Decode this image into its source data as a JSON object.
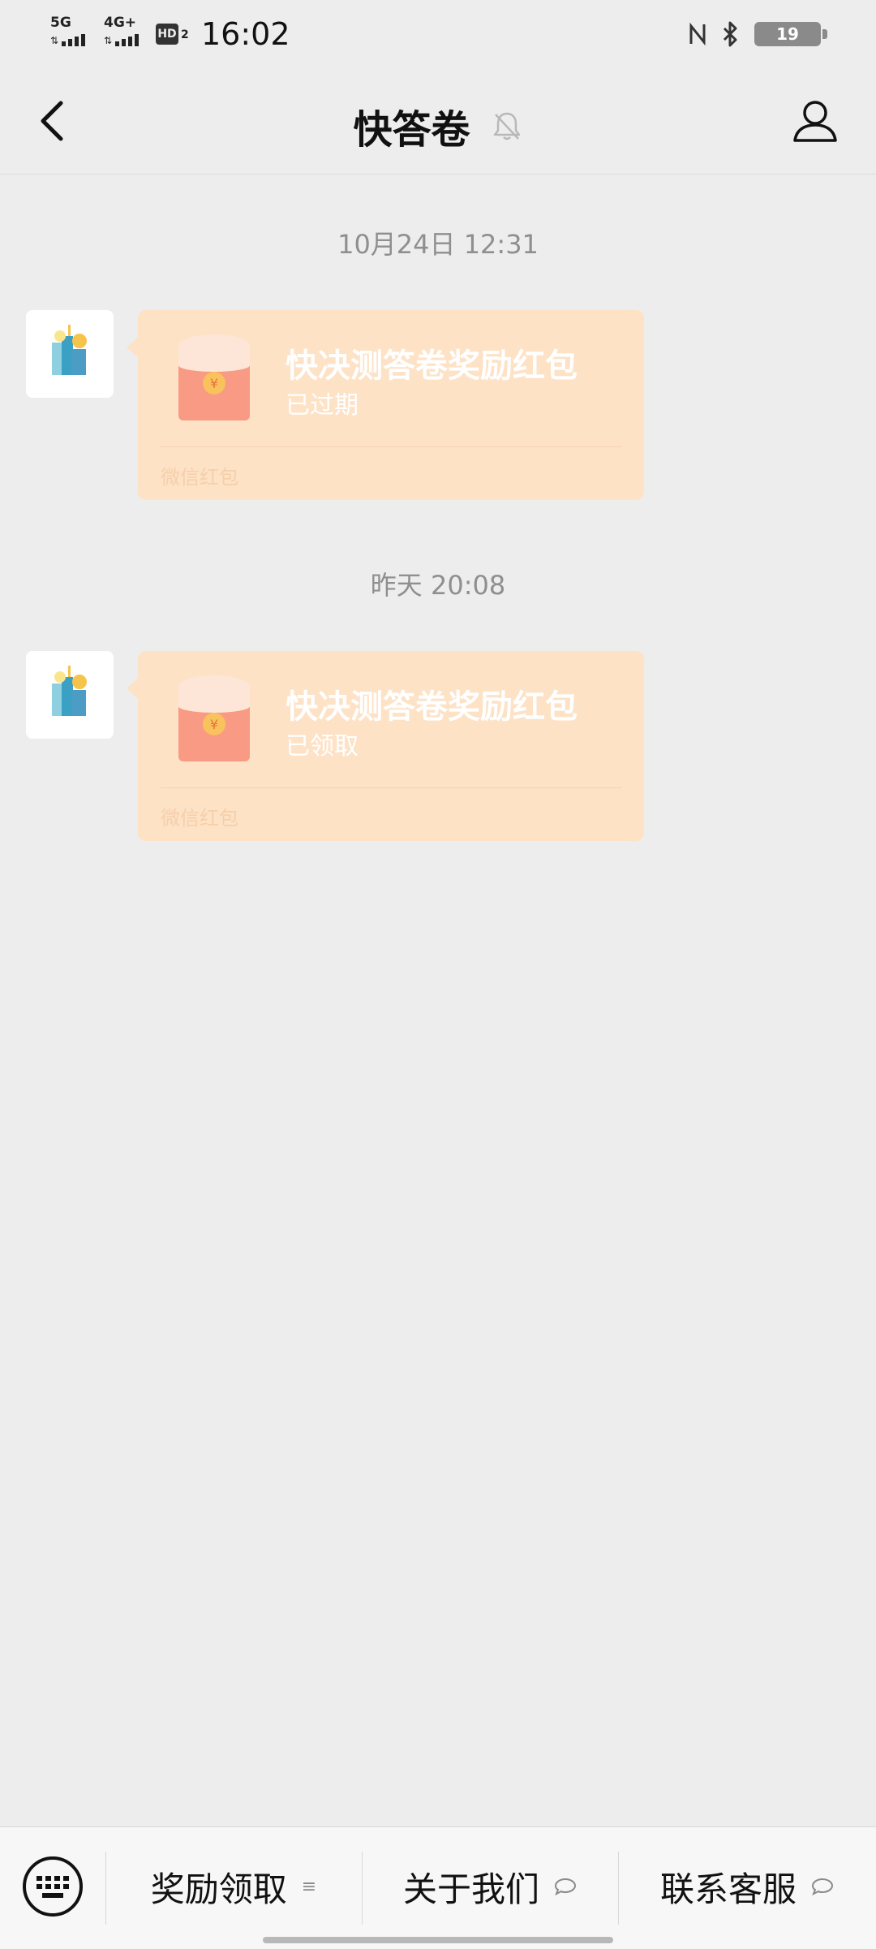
{
  "status_bar": {
    "network1": "5G",
    "network2": "4G+",
    "hd_label": "HD",
    "hd_num": "2",
    "time": "16:02",
    "battery": "19",
    "icons": [
      "nfc-icon",
      "bluetooth-icon",
      "battery-icon"
    ]
  },
  "header": {
    "title": "快答卷",
    "icons": [
      "back-arrow-icon",
      "mute-bell-icon",
      "profile-icon"
    ]
  },
  "messages": [
    {
      "timestamp": "10月24日 12:31",
      "title": "快决测答卷奖励红包",
      "status": "已过期",
      "footer": "微信红包"
    },
    {
      "timestamp": "昨天 20:08",
      "title": "快决测答卷奖励红包",
      "status": "已领取",
      "footer": "微信红包"
    }
  ],
  "menu": {
    "keyboard_icon": "keyboard-icon",
    "items": [
      {
        "label": "奖励领取",
        "indicator": "≡"
      },
      {
        "label": "关于我们",
        "indicator": "○"
      },
      {
        "label": "联系客服",
        "indicator": "○"
      }
    ]
  },
  "colors": {
    "background": "#ededed",
    "bubble": "#fde2c6",
    "packet_red": "#f89a84",
    "coin": "#f6c34b"
  }
}
